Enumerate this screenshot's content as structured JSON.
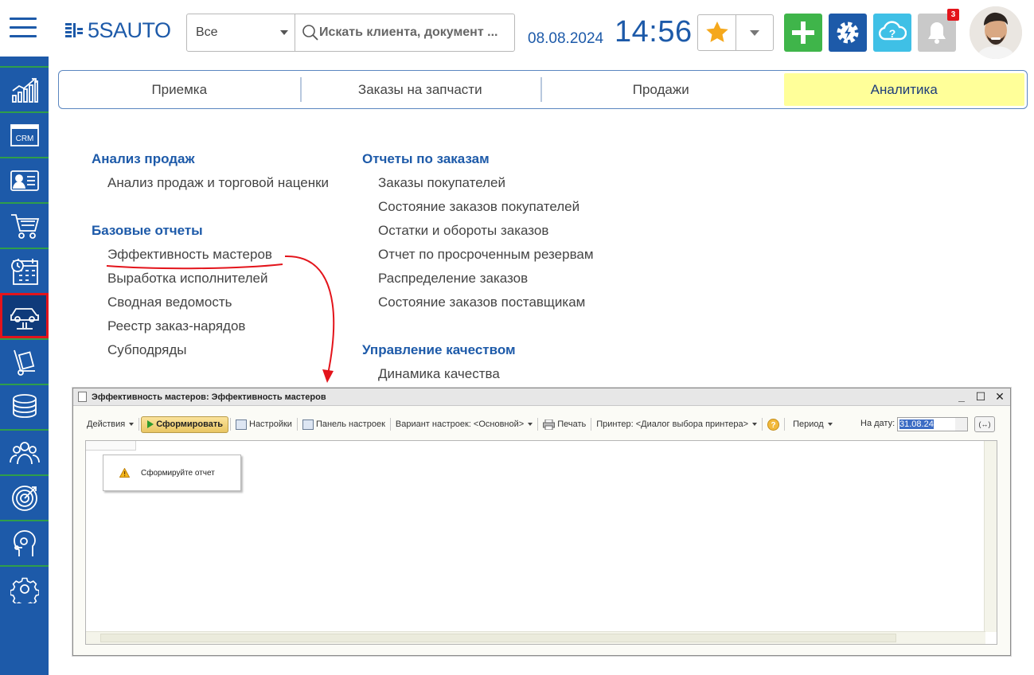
{
  "header": {
    "logo_text": "5SAUTO",
    "search_scope": "Все",
    "search_placeholder": "Искать клиента, документ ...",
    "date": "08.08.2024",
    "time": "14:56",
    "notification_count": "3",
    "colors": {
      "brand": "#1d5aa9",
      "add": "#3fb54a",
      "help": "#3fc0e6",
      "star": "#f5a81c"
    }
  },
  "sidebar": {
    "items": [
      {
        "name": "analytics",
        "icon": "bar-chart-icon"
      },
      {
        "name": "crm",
        "icon": "crm-icon",
        "label": "CRM"
      },
      {
        "name": "contacts",
        "icon": "id-card-icon"
      },
      {
        "name": "shop",
        "icon": "cart-icon"
      },
      {
        "name": "calendar",
        "icon": "calendar-icon"
      },
      {
        "name": "service",
        "icon": "car-lift-icon",
        "active": true
      },
      {
        "name": "parts",
        "icon": "trolley-icon"
      },
      {
        "name": "finance",
        "icon": "coins-icon"
      },
      {
        "name": "staff",
        "icon": "people-icon"
      },
      {
        "name": "goals",
        "icon": "target-icon"
      },
      {
        "name": "support",
        "icon": "head-icon"
      },
      {
        "name": "settings",
        "icon": "gear-icon"
      }
    ]
  },
  "tabs": [
    {
      "label": "Приемка",
      "active": false
    },
    {
      "label": "Заказы на запчасти",
      "active": false
    },
    {
      "label": "Продажи",
      "active": false
    },
    {
      "label": "Аналитика",
      "active": true
    }
  ],
  "menu": {
    "left": {
      "groups": [
        {
          "title": "Анализ продаж",
          "links": [
            "Анализ продаж и торговой наценки"
          ]
        },
        {
          "title": "Базовые отчеты",
          "links": [
            "Эффективность мастеров",
            "Выработка исполнителей",
            "Сводная ведомость",
            "Реестр заказ-нарядов",
            "Субподряды"
          ]
        }
      ]
    },
    "right": {
      "groups": [
        {
          "title": "Отчеты по заказам",
          "links": [
            "Заказы покупателей",
            "Состояние заказов покупателей",
            "Остатки и обороты заказов",
            "Отчет по просроченным резервам",
            "Распределение заказов",
            "Состояние заказов поставщикам"
          ]
        },
        {
          "title": "Управление качеством",
          "links": [
            "Динамика качества"
          ]
        }
      ]
    }
  },
  "report_window": {
    "title": "Эффективность мастеров: Эффективность мастеров",
    "toolbar": {
      "actions": "Действия",
      "generate": "Сформировать",
      "settings": "Настройки",
      "settings_panel": "Панель настроек",
      "variant": "Вариант настроек: <Основной>",
      "print": "Печать",
      "printer": "Принтер: <Диалог выбора принтера>",
      "help": "?",
      "period": "Период",
      "date_label": "На дату:",
      "date_value": "31.08.24",
      "period_btn": "(↔)"
    },
    "message": "Сформируйте отчет"
  }
}
